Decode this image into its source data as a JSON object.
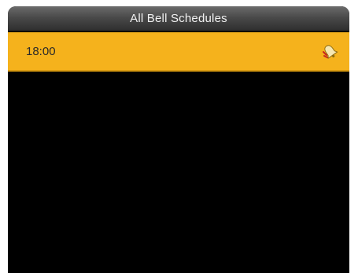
{
  "screen": {
    "title": "All Bell Schedules"
  },
  "schedules": [
    {
      "time": "18:00",
      "icon": "bell-icon",
      "selected": true
    }
  ],
  "colors": {
    "highlight": "#f5b21c",
    "background": "#000000",
    "title_text": "#f2f2f2"
  }
}
